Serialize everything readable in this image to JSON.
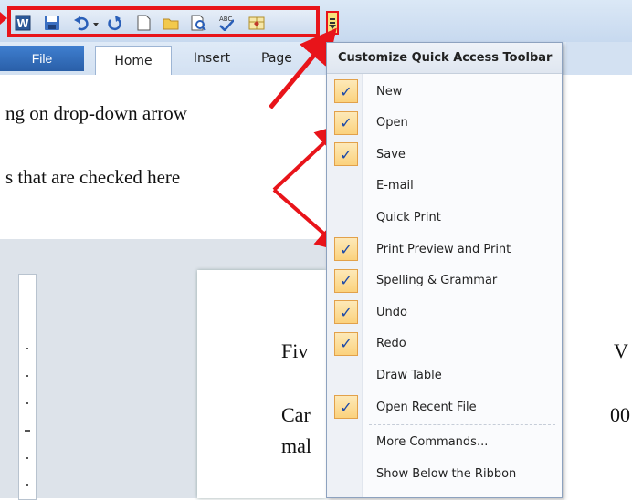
{
  "toolbar": {
    "icons": [
      "word-icon",
      "save-icon",
      "undo-icon",
      "redo-icon",
      "new-icon",
      "open-icon",
      "print-preview-icon",
      "spelling-icon",
      "table-icon"
    ]
  },
  "ribbon": {
    "tabs": [
      {
        "label": "File"
      },
      {
        "label": "Home"
      },
      {
        "label": "Insert"
      },
      {
        "label": "Page"
      }
    ]
  },
  "annotations": {
    "line1": "ng on drop-down arrow",
    "line2": "s that are checked here"
  },
  "document": {
    "word1": "Fiv",
    "word2": "Car",
    "word3": "mal",
    "right1": "V",
    "right2": "00"
  },
  "menu": {
    "title": "Customize Quick Access Toolbar",
    "items": [
      {
        "label": "New",
        "checked": true
      },
      {
        "label": "Open",
        "checked": true
      },
      {
        "label": "Save",
        "checked": true
      },
      {
        "label": "E-mail",
        "checked": false
      },
      {
        "label": "Quick Print",
        "checked": false
      },
      {
        "label": "Print Preview and Print",
        "checked": true
      },
      {
        "label": "Spelling & Grammar",
        "checked": true
      },
      {
        "label": "Undo",
        "checked": true
      },
      {
        "label": "Redo",
        "checked": true
      },
      {
        "label": "Draw Table",
        "checked": false
      },
      {
        "label": "Open Recent File",
        "checked": true
      },
      {
        "label": "More Commands...",
        "checked": false
      },
      {
        "label": "Show Below the Ribbon",
        "checked": false
      }
    ],
    "check_glyph": "✓"
  },
  "colors": {
    "highlight_red": "#e8141a",
    "check_bg": "#fbd27d",
    "file_tab": "#2a5fa8"
  }
}
